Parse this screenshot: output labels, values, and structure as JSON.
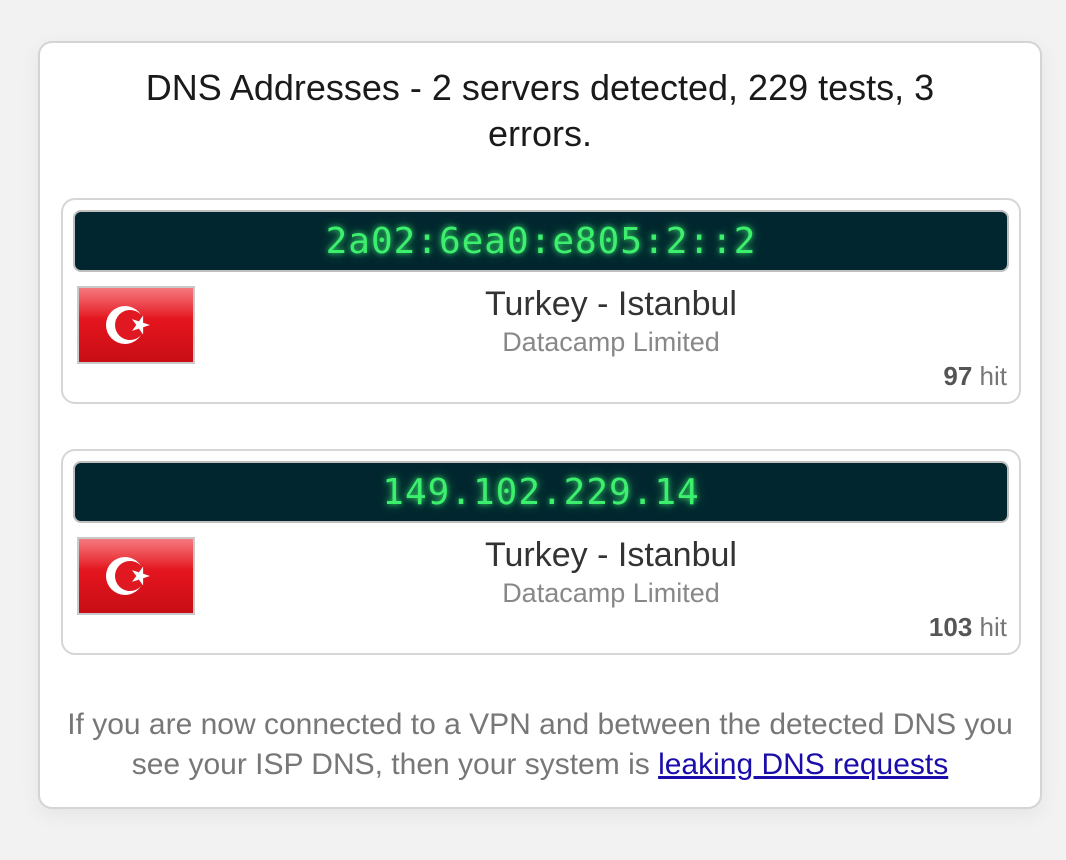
{
  "title": "DNS Addresses - 2 servers detected, 229 tests, 3 errors.",
  "servers": [
    {
      "ip": "2a02:6ea0:e805:2::2",
      "flag_icon": "turkey-flag-icon",
      "location": "Turkey - Istanbul",
      "isp": "Datacamp Limited",
      "hits_count": "97",
      "hits_label": "hit"
    },
    {
      "ip": "149.102.229.14",
      "flag_icon": "turkey-flag-icon",
      "location": "Turkey - Istanbul",
      "isp": "Datacamp Limited",
      "hits_count": "103",
      "hits_label": "hit"
    }
  ],
  "note": {
    "text": "If you are now connected to a VPN and between the detected DNS you see your ISP DNS, then your system is ",
    "link_text": "leaking DNS requests"
  },
  "colors": {
    "ip_bar_bg": "#02262f",
    "ip_text": "#3cf06e",
    "flag_red": "#e3141d",
    "link": "#1a0dab"
  }
}
